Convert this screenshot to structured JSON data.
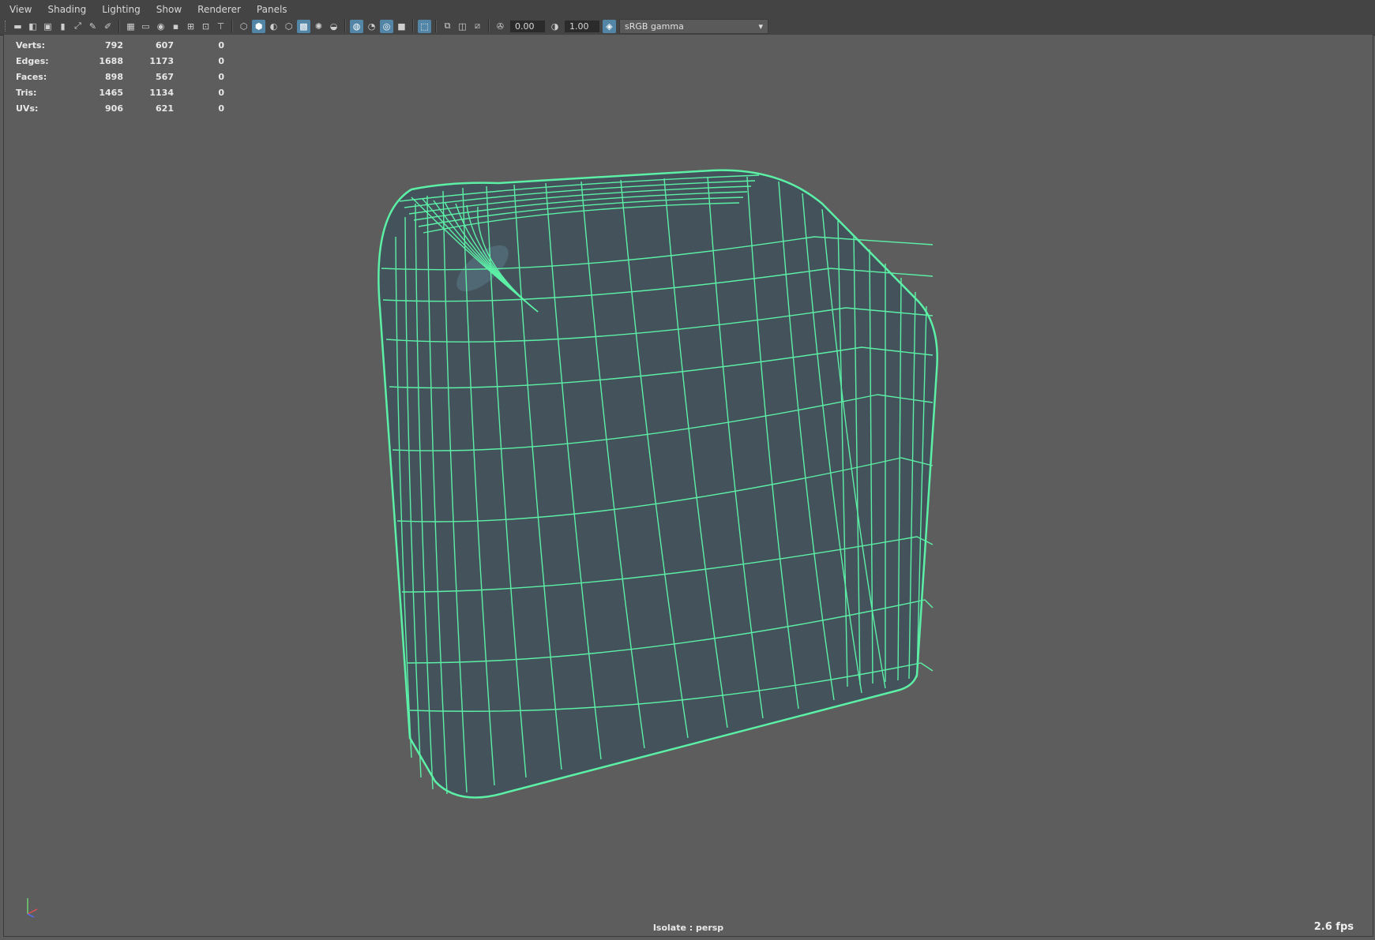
{
  "menu": [
    "View",
    "Shading",
    "Lighting",
    "Show",
    "Renderer",
    "Panels"
  ],
  "toolbar": {
    "exposure_value": "0.00",
    "gamma_value": "1.00",
    "color_space": "sRGB gamma"
  },
  "hud": {
    "rows": [
      {
        "label": "Verts:",
        "values": [
          "792",
          "607",
          "0"
        ]
      },
      {
        "label": "Edges:",
        "values": [
          "1688",
          "1173",
          "0"
        ]
      },
      {
        "label": "Faces:",
        "values": [
          "898",
          "567",
          "0"
        ]
      },
      {
        "label": "Tris:",
        "values": [
          "1465",
          "1134",
          "0"
        ]
      },
      {
        "label": "UVs:",
        "values": [
          "906",
          "621",
          "0"
        ]
      }
    ]
  },
  "viewport": {
    "isolate_label": "Isolate : persp",
    "fps": "2.6 fps",
    "wire_color": "#5cf0a6",
    "surface_color": "#44525c",
    "background_color": "#5d5d5d"
  }
}
